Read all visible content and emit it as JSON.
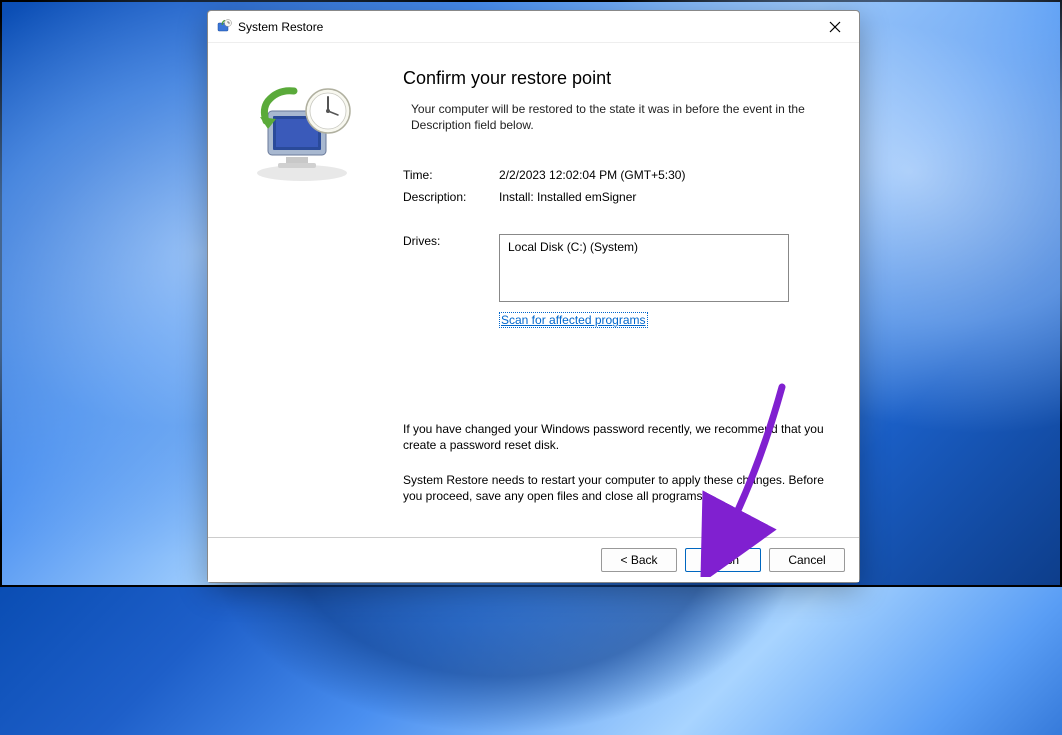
{
  "dialog": {
    "title": "System Restore",
    "heading": "Confirm your restore point",
    "subtext": "Your computer will be restored to the state it was in before the event in the Description field below.",
    "time_label": "Time:",
    "time_value": "2/2/2023 12:02:04 PM (GMT+5:30)",
    "desc_label": "Description:",
    "desc_value": "Install: Installed emSigner",
    "drives_label": "Drives:",
    "drives_value": "Local Disk (C:) (System)",
    "scan_link": "Scan for affected programs",
    "warning1": "If you have changed your Windows password recently, we recommend that you create a password reset disk.",
    "warning2": "System Restore needs to restart your computer to apply these changes. Before you proceed, save any open files and close all programs.",
    "buttons": {
      "back": "< Back",
      "finish": "Finish",
      "cancel": "Cancel"
    }
  }
}
